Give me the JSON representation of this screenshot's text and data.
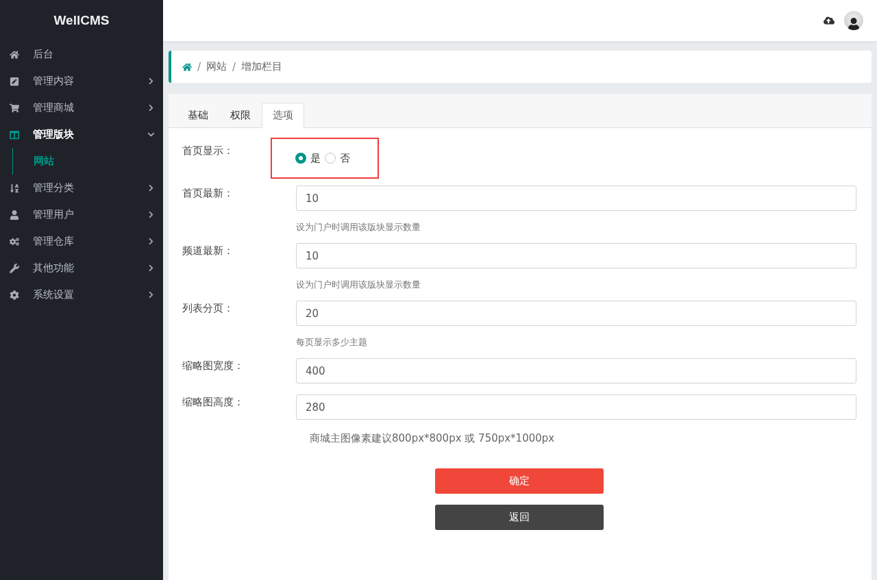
{
  "sidebar": {
    "brand": "WellCMS",
    "items": [
      {
        "label": "后台",
        "selected": false
      },
      {
        "label": "管理内容",
        "selected": false,
        "expanded": false
      },
      {
        "label": "管理商城",
        "selected": false,
        "expanded": false
      },
      {
        "label": "管理版块",
        "selected": true,
        "expanded": true,
        "children": [
          {
            "label": "网站",
            "selected": true
          }
        ]
      },
      {
        "label": "管理分类",
        "selected": false,
        "expanded": false
      },
      {
        "label": "管理用户",
        "selected": false,
        "expanded": false
      },
      {
        "label": "管理仓库",
        "selected": false,
        "expanded": false
      },
      {
        "label": "其他功能",
        "selected": false,
        "expanded": false
      },
      {
        "label": "系统设置",
        "selected": false,
        "expanded": false
      }
    ]
  },
  "breadcrumb": [
    {
      "separator": "/",
      "label": "网站"
    },
    {
      "separator": "/",
      "label": "增加栏目"
    }
  ],
  "tabs": [
    {
      "label": "基础",
      "selected": false
    },
    {
      "label": "权限",
      "selected": false
    },
    {
      "label": "选项",
      "selected": true
    }
  ],
  "form": [
    {
      "kind": "radio",
      "label": "首页显示：",
      "highlighted": true,
      "options": [
        {
          "label": "是",
          "selected": true
        },
        {
          "label": "否",
          "selected": false
        }
      ]
    },
    {
      "kind": "input",
      "label": "首页最新：",
      "value": "10",
      "help": "设为门户时调用该版块显示数量"
    },
    {
      "kind": "input",
      "label": "频道最新：",
      "value": "10",
      "help": "设为门户时调用该版块显示数量"
    },
    {
      "kind": "input",
      "label": "列表分页：",
      "value": "20",
      "help": "每页显示多少主题"
    },
    {
      "kind": "input",
      "label": "缩略图宽度：",
      "value": "400"
    },
    {
      "kind": "input",
      "label": "缩略图高度：",
      "value": "280"
    }
  ],
  "note": "商城主图像素建议800px*800px 或 750px*1000px",
  "buttons": [
    {
      "label": "确定",
      "kind": "primary"
    },
    {
      "label": "返回",
      "kind": "secondary"
    }
  ]
}
